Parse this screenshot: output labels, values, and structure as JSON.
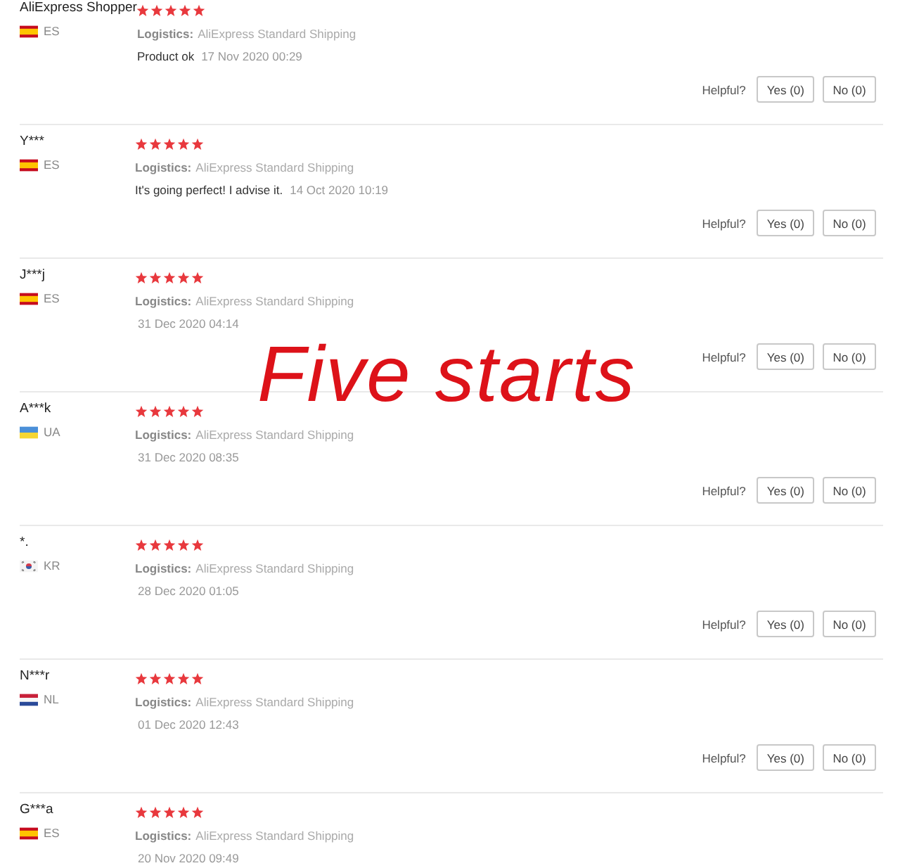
{
  "reviews": [
    {
      "name": "AliExpress Shopper",
      "flag": {
        "kind": "spain"
      },
      "country": "ES",
      "stars": 5,
      "logistics_label": "Logistics:",
      "logistics": "AliExpress Standard Shipping",
      "comment": "Product ok",
      "date": "17 Nov 2020 00:29",
      "helpful_label": "Helpful?",
      "yes": "Yes (0)",
      "no": "No (0)"
    },
    {
      "name": "Y***",
      "flag": {
        "kind": "spain"
      },
      "country": "ES",
      "stars": 5,
      "logistics_label": "Logistics:",
      "logistics": "AliExpress Standard Shipping",
      "comment": "It's going perfect! I advise it.",
      "date": "14 Oct 2020 10:19",
      "helpful_label": "Helpful?",
      "yes": "Yes (0)",
      "no": "No (0)"
    },
    {
      "name": "J***j",
      "flag": {
        "kind": "spain"
      },
      "country": "ES",
      "stars": 5,
      "logistics_label": "Logistics:",
      "logistics": "AliExpress Standard Shipping",
      "date": "31 Dec 2020 04:14",
      "helpful_label": "Helpful?",
      "yes": "Yes (0)",
      "no": "No (0)"
    },
    {
      "name": "A***k",
      "flag": {
        "kind": "ukraine"
      },
      "country": "UA",
      "stars": 5,
      "logistics_label": "Logistics:",
      "logistics": "AliExpress Standard Shipping",
      "date": "31 Dec 2020 08:35",
      "helpful_label": "Helpful?",
      "yes": "Yes (0)",
      "no": "No (0)"
    },
    {
      "name": "*.",
      "flag": {
        "kind": "korea"
      },
      "country": "KR",
      "stars": 5,
      "logistics_label": "Logistics:",
      "logistics": "AliExpress Standard Shipping",
      "date": "28 Dec 2020 01:05",
      "helpful_label": "Helpful?",
      "yes": "Yes (0)",
      "no": "No (0)"
    },
    {
      "name": "N***r",
      "flag": {
        "kind": "netherlands"
      },
      "country": "NL",
      "stars": 5,
      "logistics_label": "Logistics:",
      "logistics": "AliExpress Standard Shipping",
      "date": "01 Dec 2020 12:43",
      "helpful_label": "Helpful?",
      "yes": "Yes (0)",
      "no": "No (0)"
    },
    {
      "name": "G***a",
      "flag": {
        "kind": "spain"
      },
      "country": "ES",
      "stars": 5,
      "logistics_label": "Logistics:",
      "logistics": "AliExpress Standard Shipping",
      "date": "20 Nov 2020 09:49"
    }
  ],
  "annotation": "Five starts"
}
